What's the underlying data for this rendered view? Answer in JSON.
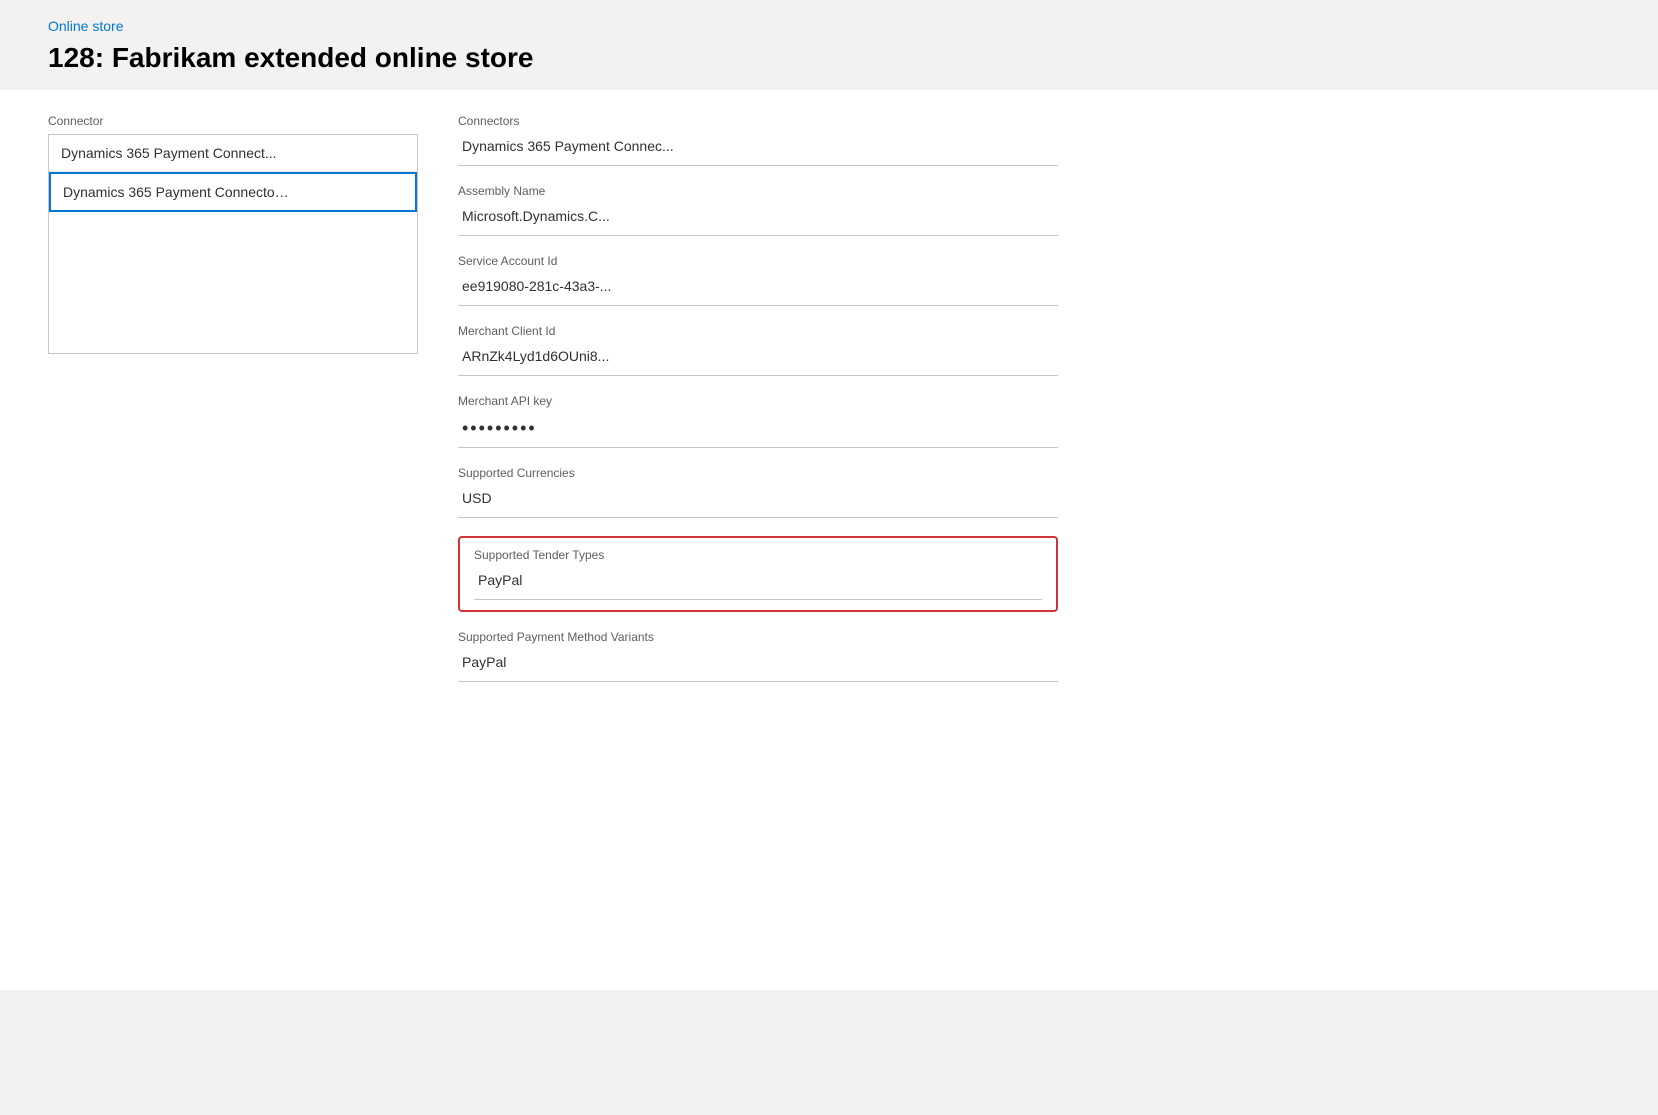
{
  "breadcrumb": {
    "label": "Online store",
    "href": "#"
  },
  "page": {
    "title": "128: Fabrikam extended online store"
  },
  "left_panel": {
    "label": "Connector",
    "items": [
      {
        "text": "Dynamics 365 Payment Connect...",
        "selected": false
      },
      {
        "text": "Dynamics 365 Payment Connecto…",
        "selected": true
      }
    ]
  },
  "right_panel": {
    "fields": [
      {
        "id": "connectors",
        "label": "Connectors",
        "value": "Dynamics 365 Payment Connec...",
        "highlighted": false,
        "password": false
      },
      {
        "id": "assembly_name",
        "label": "Assembly Name",
        "value": "Microsoft.Dynamics.C...",
        "highlighted": false,
        "password": false
      },
      {
        "id": "service_account_id",
        "label": "Service Account Id",
        "value": "ee919080-281c-43a3-...",
        "highlighted": false,
        "password": false
      },
      {
        "id": "merchant_client_id",
        "label": "Merchant Client Id",
        "value": "ARnZk4Lyd1d6OUni8...",
        "highlighted": false,
        "password": false
      },
      {
        "id": "merchant_api_key",
        "label": "Merchant API key",
        "value": "•••••••••",
        "highlighted": false,
        "password": true
      },
      {
        "id": "supported_currencies",
        "label": "Supported Currencies",
        "value": "USD",
        "highlighted": false,
        "password": false
      },
      {
        "id": "supported_tender_types",
        "label": "Supported Tender Types",
        "value": "PayPal",
        "highlighted": true,
        "password": false
      },
      {
        "id": "supported_payment_method_variants",
        "label": "Supported Payment Method Variants",
        "value": "PayPal",
        "highlighted": false,
        "password": false
      }
    ]
  }
}
